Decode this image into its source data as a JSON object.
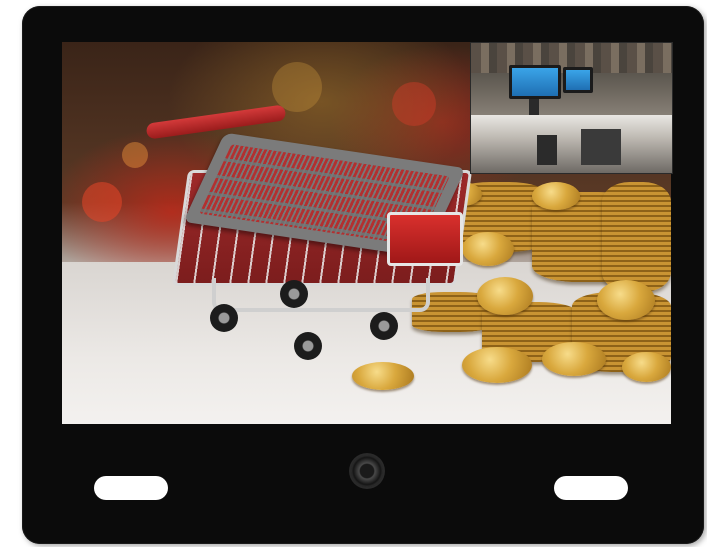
{
  "device": {
    "bezel_color": "#0b0b0b",
    "camera_icon": "camera-lens-icon",
    "left_button_color": "#ffffff",
    "right_button_color": "#ffffff"
  },
  "screen": {
    "main_image": "shopping-cart-with-calculator-and-gold-coins",
    "inset_image": "store-checkout-counter-with-monitors"
  }
}
